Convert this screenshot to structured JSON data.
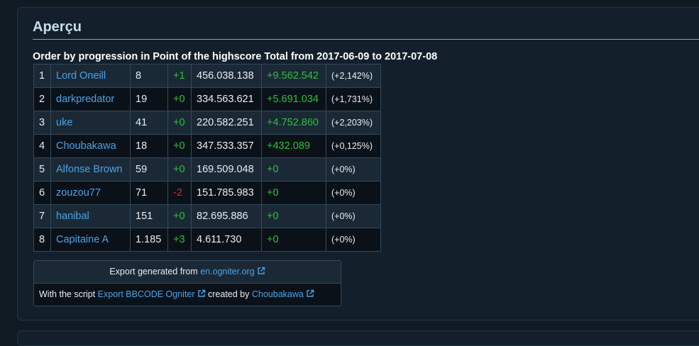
{
  "panel": {
    "title": "Aperçu",
    "caption": "Order by progression in Point of the highscore Total from 2017-06-09 to 2017-07-08"
  },
  "rows": [
    {
      "rank": "1",
      "name": "Lord Oneill",
      "position": "8",
      "pos_change": "+1",
      "points": "456.038.138",
      "gain": "+9.562.542",
      "percent": "(+2,142%)"
    },
    {
      "rank": "2",
      "name": "darkpredator",
      "position": "19",
      "pos_change": "+0",
      "points": "334.563.621",
      "gain": "+5.691.034",
      "percent": "(+1,731%)"
    },
    {
      "rank": "3",
      "name": "uke",
      "position": "41",
      "pos_change": "+0",
      "points": "220.582.251",
      "gain": "+4.752.860",
      "percent": "(+2,203%)"
    },
    {
      "rank": "4",
      "name": "Choubakawa",
      "position": "18",
      "pos_change": "+0",
      "points": "347.533.357",
      "gain": "+432.089",
      "percent": "(+0,125%)"
    },
    {
      "rank": "5",
      "name": "Alfonse Brown",
      "position": "59",
      "pos_change": "+0",
      "points": "169.509.048",
      "gain": "+0",
      "percent": "(+0%)"
    },
    {
      "rank": "6",
      "name": "zouzou77",
      "position": "71",
      "pos_change": "-2",
      "points": "151.785.983",
      "gain": "+0",
      "percent": "(+0%)"
    },
    {
      "rank": "7",
      "name": "hanibal",
      "position": "151",
      "pos_change": "+0",
      "points": "82.695.886",
      "gain": "+0",
      "percent": "(+0%)"
    },
    {
      "rank": "8",
      "name": "Capitaine A",
      "position": "1.185",
      "pos_change": "+3",
      "points": "4.611.730",
      "gain": "+0",
      "percent": "(+0%)"
    }
  ],
  "export": {
    "generated_prefix": "Export generated from ",
    "generated_link": "en.ogniter.org",
    "script_prefix": "With the script ",
    "script_link": "Export BBCODE Ogniter",
    "created_by": " created by ",
    "author_link": "Choubakawa"
  },
  "colors": {
    "link": "#4aa3e8",
    "positive": "#2fbf3f",
    "negative": "#e0252a"
  },
  "icons": {
    "external_link": "external-link-icon"
  }
}
